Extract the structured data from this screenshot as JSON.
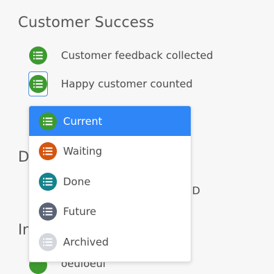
{
  "section": {
    "title": "Customer Success"
  },
  "items": [
    {
      "label": "Customer feedback collected",
      "status": "current"
    },
    {
      "label": "Happy customer counted",
      "status": "current"
    }
  ],
  "background_fragments": {
    "section2_initial": "D",
    "item_suffix": "D",
    "section3_initial": "In",
    "bottom_item_label": "oeuloeul"
  },
  "status_menu": {
    "selected": "Current",
    "options": [
      {
        "label": "Current",
        "color": "#3d9a2f"
      },
      {
        "label": "Waiting",
        "color": "#d4560f"
      },
      {
        "label": "Done",
        "color": "#14838c"
      },
      {
        "label": "Future",
        "color": "#5b6376"
      },
      {
        "label": "Archived",
        "color": "#d3d6dc"
      }
    ]
  },
  "colors": {
    "accent": "#2f86f6",
    "focus_border": "#4a90d9",
    "current_green": "#3d9a2f"
  },
  "icon": "list-icon"
}
